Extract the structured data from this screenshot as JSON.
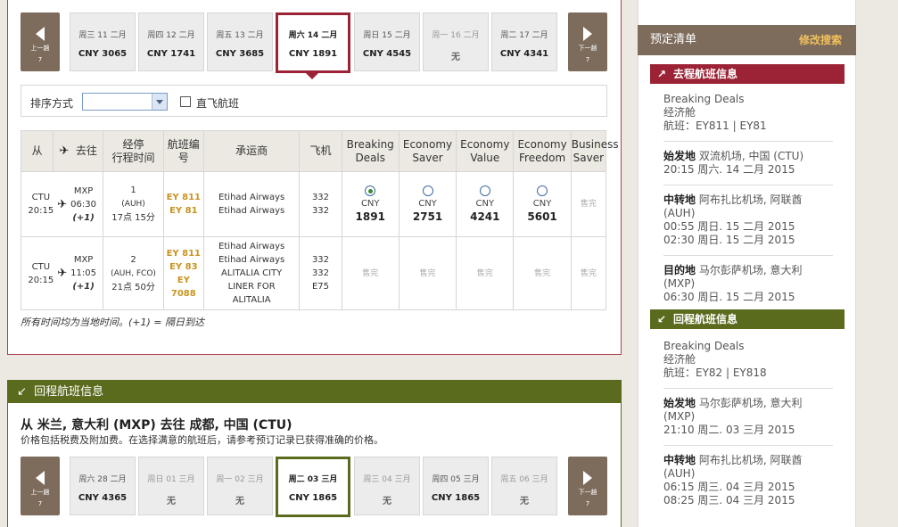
{
  "outbound_strip": {
    "prev": {
      "label": "上一趟",
      "sub": "7"
    },
    "next": {
      "label": "下一趟",
      "sub": "7"
    },
    "days": [
      {
        "label": "周三 11 二月",
        "price": "CNY 3065"
      },
      {
        "label": "周四 12 二月",
        "price": "CNY 1741"
      },
      {
        "label": "周五 13 二月",
        "price": "CNY 3685"
      },
      {
        "label": "周六 14 二月",
        "price": "CNY 1891"
      },
      {
        "label": "周日 15 二月",
        "price": "CNY 4545"
      },
      {
        "label": "周一 16 二月",
        "price": "无"
      },
      {
        "label": "周二 17 二月",
        "price": "CNY 4341"
      }
    ]
  },
  "sort": {
    "label": "排序方式",
    "selected": "",
    "direct_label": "直飞航班"
  },
  "table": {
    "headers": {
      "from": "从",
      "to": "去往",
      "stops": "经停\n行程时间",
      "flight": "航班编\n号",
      "carrier": "承运商",
      "aircraft": "飞机",
      "f1": "Breaking\nDeals",
      "f2": "Economy\nSaver",
      "f3": "Economy\nValue",
      "f4": "Economy\nFreedom",
      "f5": "Business\nSaver"
    },
    "rows": [
      {
        "from_code": "CTU",
        "from_time": "20:15",
        "to_code": "MXP",
        "to_time": "06:30",
        "to_plus": "(+1)",
        "stops": "1",
        "via": "(AUH)",
        "duration": "17点 15分",
        "codes": [
          "EY 811",
          "EY 81"
        ],
        "carriers": [
          "Etihad Airways",
          "Etihad Airways"
        ],
        "aircraft": [
          "332",
          "332"
        ],
        "fares": [
          {
            "cur": "CNY",
            "val": "1891",
            "selected": true
          },
          {
            "cur": "CNY",
            "val": "2751",
            "selected": false
          },
          {
            "cur": "CNY",
            "val": "4241",
            "selected": false
          },
          {
            "cur": "CNY",
            "val": "5601",
            "selected": false
          }
        ],
        "f5": "售完"
      },
      {
        "from_code": "CTU",
        "from_time": "20:15",
        "to_code": "MXP",
        "to_time": "11:05",
        "to_plus": "(+1)",
        "stops": "2",
        "via": "(AUH, FCO)",
        "duration": "21点 50分",
        "codes": [
          "EY 811",
          "EY 83",
          "EY 7088"
        ],
        "carriers": [
          "Etihad Airways",
          "Etihad Airways",
          "ALITALIA CITY",
          "LINER FOR",
          "ALITALIA"
        ],
        "aircraft": [
          "332",
          "332",
          "E75"
        ],
        "soldout": "售完"
      }
    ]
  },
  "note": "所有时间均为当地时间。(+1) = 隔日到达",
  "return": {
    "header": "回程航班信息",
    "title": "从 米兰, 意大利 (MXP) 去往 成都, 中国 (CTU)",
    "subtitle": "价格包括税费及附加费。在选择满意的航班后，请参考预订记录已获得准确的价格。",
    "prev": {
      "label": "上一趟",
      "sub": "7"
    },
    "next": {
      "label": "下一趟",
      "sub": "7"
    },
    "days": [
      {
        "label": "周六 28 二月",
        "price": "CNY 4365"
      },
      {
        "label": "周日 01 三月",
        "price": "无"
      },
      {
        "label": "周一 02 三月",
        "price": "无"
      },
      {
        "label": "周二 03 三月",
        "price": "CNY 1865"
      },
      {
        "label": "周三 04 三月",
        "price": "无"
      },
      {
        "label": "周四 05 三月",
        "price": "CNY 1865"
      },
      {
        "label": "周五 06 三月",
        "price": "无"
      }
    ]
  },
  "booking": {
    "title": "预定清单",
    "edit": "修改搜索",
    "out_head": "去程航班信息",
    "out_fare": "Breaking Deals",
    "out_cabin": "经济舱",
    "out_flights": "航班：EY811 | EY81",
    "out_dep_label": "始发地",
    "out_dep_place": "双流机场, 中国 (CTU)",
    "out_dep_time": "20:15 周六. 14 二月 2015",
    "out_tr_label": "中转地",
    "out_tr_place": "阿布扎比机场, 阿联酋",
    "out_tr_code": "(AUH)",
    "out_tr_time1": "00:55 周日. 15 二月 2015",
    "out_tr_time2": "02:30 周日. 15 二月 2015",
    "out_arr_label": "目的地",
    "out_arr_place": "马尔彭萨机场, 意大利",
    "out_arr_code": "(MXP)",
    "out_arr_time": "06:30 周日. 15 二月 2015",
    "in_head": "回程航班信息",
    "in_fare": "Breaking Deals",
    "in_cabin": "经济舱",
    "in_flights": "航班：EY82 | EY818",
    "in_dep_label": "始发地",
    "in_dep_place": "马尔彭萨机场, 意大利",
    "in_dep_code": "(MXP)",
    "in_dep_time": "21:10 周二. 03 三月 2015",
    "in_tr_label": "中转地",
    "in_tr_place": "阿布扎比机场, 阿联酋",
    "in_tr_code": "(AUH)",
    "in_tr_time1": "06:15 周三. 04 三月 2015",
    "in_tr_time2": "08:25 周三. 04 三月 2015"
  },
  "colors": {
    "outbound": "#9b2335",
    "return": "#5a6b1e",
    "brand": "#7d6c5c",
    "code": "#c99420"
  }
}
